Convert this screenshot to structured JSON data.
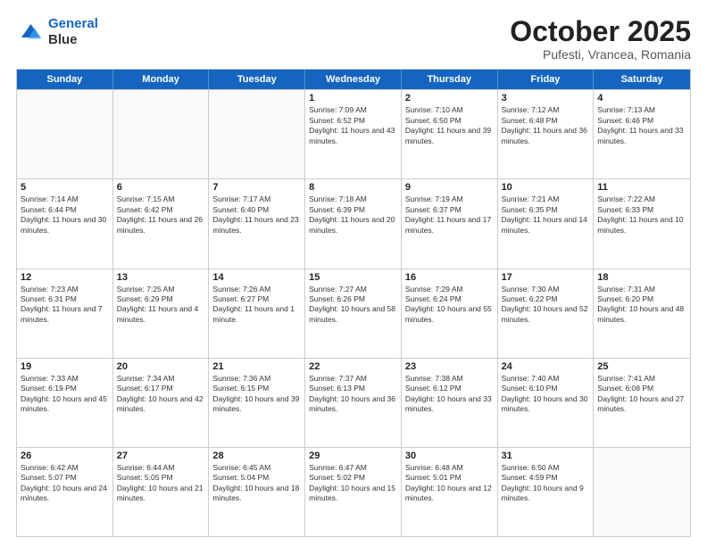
{
  "header": {
    "logo_line1": "General",
    "logo_line2": "Blue",
    "month": "October 2025",
    "location": "Pufesti, Vrancea, Romania"
  },
  "weekdays": [
    "Sunday",
    "Monday",
    "Tuesday",
    "Wednesday",
    "Thursday",
    "Friday",
    "Saturday"
  ],
  "weeks": [
    [
      {
        "day": "",
        "info": ""
      },
      {
        "day": "",
        "info": ""
      },
      {
        "day": "",
        "info": ""
      },
      {
        "day": "1",
        "info": "Sunrise: 7:09 AM\nSunset: 6:52 PM\nDaylight: 11 hours and 43 minutes."
      },
      {
        "day": "2",
        "info": "Sunrise: 7:10 AM\nSunset: 6:50 PM\nDaylight: 11 hours and 39 minutes."
      },
      {
        "day": "3",
        "info": "Sunrise: 7:12 AM\nSunset: 6:48 PM\nDaylight: 11 hours and 36 minutes."
      },
      {
        "day": "4",
        "info": "Sunrise: 7:13 AM\nSunset: 6:46 PM\nDaylight: 11 hours and 33 minutes."
      }
    ],
    [
      {
        "day": "5",
        "info": "Sunrise: 7:14 AM\nSunset: 6:44 PM\nDaylight: 11 hours and 30 minutes."
      },
      {
        "day": "6",
        "info": "Sunrise: 7:15 AM\nSunset: 6:42 PM\nDaylight: 11 hours and 26 minutes."
      },
      {
        "day": "7",
        "info": "Sunrise: 7:17 AM\nSunset: 6:40 PM\nDaylight: 11 hours and 23 minutes."
      },
      {
        "day": "8",
        "info": "Sunrise: 7:18 AM\nSunset: 6:39 PM\nDaylight: 11 hours and 20 minutes."
      },
      {
        "day": "9",
        "info": "Sunrise: 7:19 AM\nSunset: 6:37 PM\nDaylight: 11 hours and 17 minutes."
      },
      {
        "day": "10",
        "info": "Sunrise: 7:21 AM\nSunset: 6:35 PM\nDaylight: 11 hours and 14 minutes."
      },
      {
        "day": "11",
        "info": "Sunrise: 7:22 AM\nSunset: 6:33 PM\nDaylight: 11 hours and 10 minutes."
      }
    ],
    [
      {
        "day": "12",
        "info": "Sunrise: 7:23 AM\nSunset: 6:31 PM\nDaylight: 11 hours and 7 minutes."
      },
      {
        "day": "13",
        "info": "Sunrise: 7:25 AM\nSunset: 6:29 PM\nDaylight: 11 hours and 4 minutes."
      },
      {
        "day": "14",
        "info": "Sunrise: 7:26 AM\nSunset: 6:27 PM\nDaylight: 11 hours and 1 minute."
      },
      {
        "day": "15",
        "info": "Sunrise: 7:27 AM\nSunset: 6:26 PM\nDaylight: 10 hours and 58 minutes."
      },
      {
        "day": "16",
        "info": "Sunrise: 7:29 AM\nSunset: 6:24 PM\nDaylight: 10 hours and 55 minutes."
      },
      {
        "day": "17",
        "info": "Sunrise: 7:30 AM\nSunset: 6:22 PM\nDaylight: 10 hours and 52 minutes."
      },
      {
        "day": "18",
        "info": "Sunrise: 7:31 AM\nSunset: 6:20 PM\nDaylight: 10 hours and 48 minutes."
      }
    ],
    [
      {
        "day": "19",
        "info": "Sunrise: 7:33 AM\nSunset: 6:19 PM\nDaylight: 10 hours and 45 minutes."
      },
      {
        "day": "20",
        "info": "Sunrise: 7:34 AM\nSunset: 6:17 PM\nDaylight: 10 hours and 42 minutes."
      },
      {
        "day": "21",
        "info": "Sunrise: 7:36 AM\nSunset: 6:15 PM\nDaylight: 10 hours and 39 minutes."
      },
      {
        "day": "22",
        "info": "Sunrise: 7:37 AM\nSunset: 6:13 PM\nDaylight: 10 hours and 36 minutes."
      },
      {
        "day": "23",
        "info": "Sunrise: 7:38 AM\nSunset: 6:12 PM\nDaylight: 10 hours and 33 minutes."
      },
      {
        "day": "24",
        "info": "Sunrise: 7:40 AM\nSunset: 6:10 PM\nDaylight: 10 hours and 30 minutes."
      },
      {
        "day": "25",
        "info": "Sunrise: 7:41 AM\nSunset: 6:08 PM\nDaylight: 10 hours and 27 minutes."
      }
    ],
    [
      {
        "day": "26",
        "info": "Sunrise: 6:42 AM\nSunset: 5:07 PM\nDaylight: 10 hours and 24 minutes."
      },
      {
        "day": "27",
        "info": "Sunrise: 6:44 AM\nSunset: 5:05 PM\nDaylight: 10 hours and 21 minutes."
      },
      {
        "day": "28",
        "info": "Sunrise: 6:45 AM\nSunset: 5:04 PM\nDaylight: 10 hours and 18 minutes."
      },
      {
        "day": "29",
        "info": "Sunrise: 6:47 AM\nSunset: 5:02 PM\nDaylight: 10 hours and 15 minutes."
      },
      {
        "day": "30",
        "info": "Sunrise: 6:48 AM\nSunset: 5:01 PM\nDaylight: 10 hours and 12 minutes."
      },
      {
        "day": "31",
        "info": "Sunrise: 6:50 AM\nSunset: 4:59 PM\nDaylight: 10 hours and 9 minutes."
      },
      {
        "day": "",
        "info": ""
      }
    ]
  ]
}
